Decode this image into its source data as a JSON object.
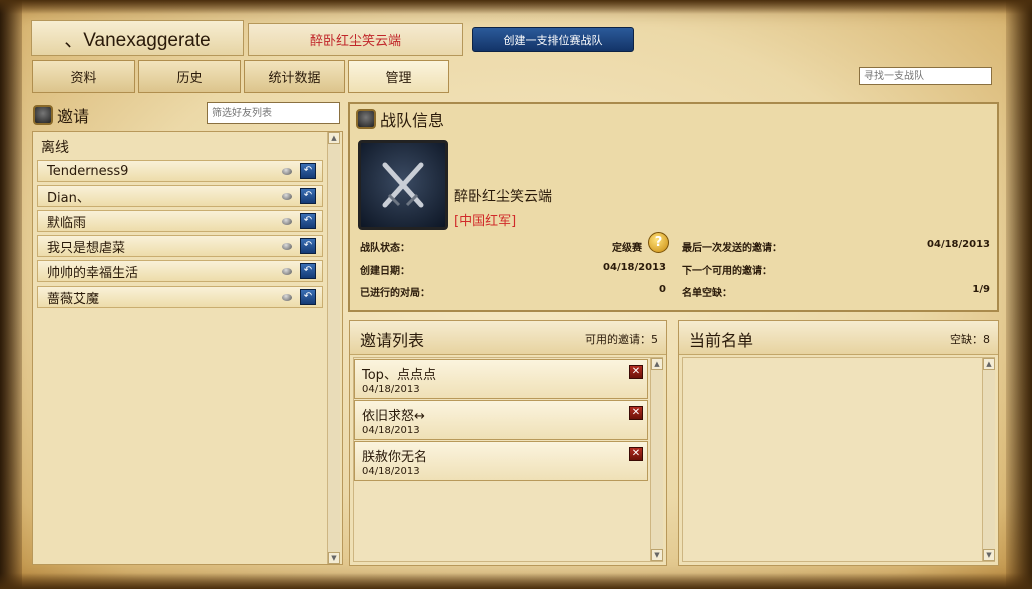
{
  "header": {
    "player_name": "、Vanexaggerate",
    "team_tab": "醉卧红尘笑云端",
    "create_team_button": "创建一支排位赛战队"
  },
  "tabs": [
    {
      "label": "资料"
    },
    {
      "label": "历史"
    },
    {
      "label": "统计数据"
    },
    {
      "label": "管理"
    }
  ],
  "search_team": {
    "placeholder": "寻找一支战队"
  },
  "invite_section": {
    "title": "邀请",
    "filter_placeholder": "筛选好友列表",
    "group_label": "离线",
    "friends": [
      {
        "name": "Tenderness9"
      },
      {
        "name": "Dian、"
      },
      {
        "name": "默临雨"
      },
      {
        "name": "我只是想虐菜"
      },
      {
        "name": "帅帅的幸福生活"
      },
      {
        "name": "蔷薇艾魔"
      }
    ]
  },
  "team_info": {
    "title": "战队信息",
    "team_name": "醉卧红尘笑云端",
    "server": "[中国红军]",
    "stats_left": [
      {
        "label": "战队状态：",
        "value": "定级赛"
      },
      {
        "label": "创建日期：",
        "value": "04/18/2013"
      },
      {
        "label": "已进行的对局：",
        "value": "0"
      }
    ],
    "stats_right": [
      {
        "label": "最后一次发送的邀请：",
        "value": "04/18/2013"
      },
      {
        "label": "下一个可用的邀请：",
        "value": ""
      },
      {
        "label": "名单空缺：",
        "value": "1/9"
      }
    ],
    "help_glyph": "?"
  },
  "invite_list": {
    "title": "邀请列表",
    "available": "可用的邀请：5",
    "items": [
      {
        "name": "Top、点点点",
        "date": "04/18/2013"
      },
      {
        "name": "依旧求怒↔",
        "date": "04/18/2013"
      },
      {
        "name": "朕赦你无名",
        "date": "04/18/2013"
      }
    ]
  },
  "roster": {
    "title": "当前名单",
    "vacancy": "空缺：8"
  },
  "icons": {
    "shield": "shield-icon",
    "invite": "invite-arrow-icon",
    "remove": "remove-x-icon",
    "crossed_swords": "crossed-swords-icon"
  },
  "colors": {
    "accent_blue": "#1c3f77",
    "team_red": "#c0262a",
    "parchment": "#ecd9a8"
  }
}
